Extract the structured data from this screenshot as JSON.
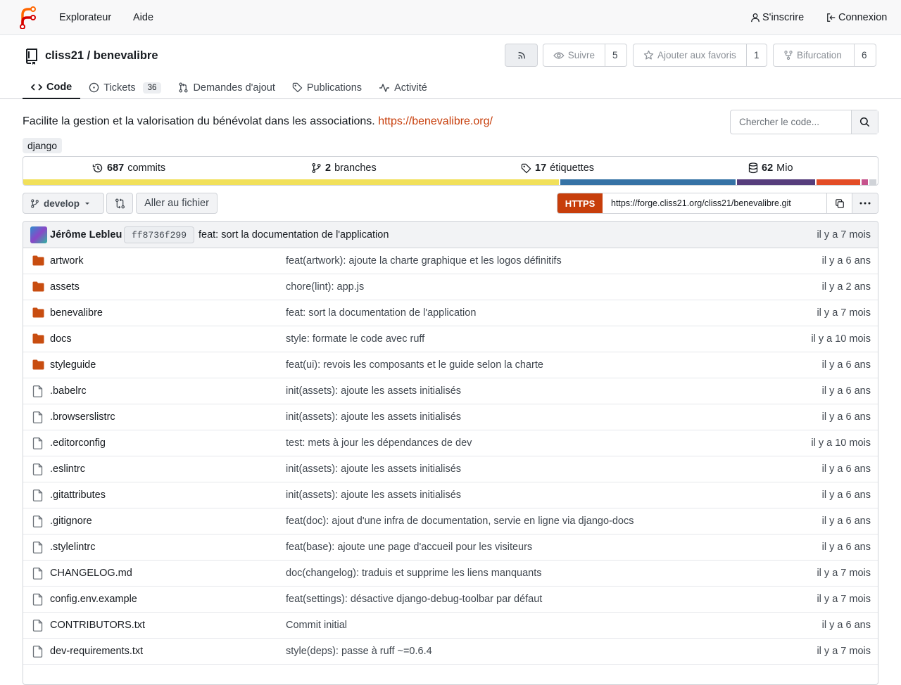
{
  "nav": {
    "explore": "Explorateur",
    "help": "Aide",
    "register": "S'inscrire",
    "login": "Connexion"
  },
  "repo": {
    "title": "cliss21 / benevalibre",
    "watch_label": "Suivre",
    "watch_count": "5",
    "star_label": "Ajouter aux favoris",
    "star_count": "1",
    "fork_label": "Bifurcation",
    "fork_count": "6"
  },
  "tabs": [
    {
      "label": "Code",
      "icon": "code-icon"
    },
    {
      "label": "Tickets",
      "icon": "issue-icon",
      "badge": "36"
    },
    {
      "label": "Demandes d'ajout",
      "icon": "pull-request-icon"
    },
    {
      "label": "Publications",
      "icon": "tag-icon"
    },
    {
      "label": "Activité",
      "icon": "pulse-icon"
    }
  ],
  "description": {
    "text": "Facilite la gestion et la valorisation du bénévolat dans les associations.",
    "link": "https://benevalibre.org/"
  },
  "search": {
    "placeholder": "Chercher le code..."
  },
  "topic": "django",
  "stats": {
    "commits_count": "687",
    "commits_label": "commits",
    "branches_count": "2",
    "branches_label": "branches",
    "tags_count": "17",
    "tags_label": "étiquettes",
    "size_count": "62",
    "size_label": "Mio"
  },
  "languages": [
    {
      "color": "#f1e05a",
      "share": 63.3
    },
    {
      "color": "#3572a5",
      "share": 20.7
    },
    {
      "color": "#563d7c",
      "share": 9.3
    },
    {
      "color": "#e34c26",
      "share": 5.1
    },
    {
      "color": "#c6538c",
      "share": 0.8
    },
    {
      "color": "#d0d3d8",
      "share": 0.8
    }
  ],
  "toolbar": {
    "branch": "develop",
    "goto_file": "Aller au fichier",
    "protocol": "HTTPS",
    "clone_url": "https://forge.cliss21.org/cliss21/benevalibre.git"
  },
  "latest_commit": {
    "author": "Jérôme Lebleu",
    "sha": "ff8736f299",
    "message": "feat: sort la documentation de l'application",
    "time": "il y a 7 mois"
  },
  "files": [
    {
      "name": "artwork",
      "type": "dir",
      "message": "feat(artwork): ajoute la charte graphique et les logos définitifs",
      "time": "il y a 6 ans"
    },
    {
      "name": "assets",
      "type": "dir",
      "message": "chore(lint): app.js",
      "time": "il y a 2 ans"
    },
    {
      "name": "benevalibre",
      "type": "dir",
      "message": "feat: sort la documentation de l'application",
      "time": "il y a 7 mois"
    },
    {
      "name": "docs",
      "type": "dir",
      "message": "style: formate le code avec ruff",
      "time": "il y a 10 mois"
    },
    {
      "name": "styleguide",
      "type": "dir",
      "message": "feat(ui): revois les composants et le guide selon la charte",
      "time": "il y a 6 ans"
    },
    {
      "name": ".babelrc",
      "type": "file",
      "message": "init(assets): ajoute les assets initialisés",
      "time": "il y a 6 ans"
    },
    {
      "name": ".browserslistrc",
      "type": "file",
      "message": "init(assets): ajoute les assets initialisés",
      "time": "il y a 6 ans"
    },
    {
      "name": ".editorconfig",
      "type": "file",
      "message": "test: mets à jour les dépendances de dev",
      "time": "il y a 10 mois"
    },
    {
      "name": ".eslintrc",
      "type": "file",
      "message": "init(assets): ajoute les assets initialisés",
      "time": "il y a 6 ans"
    },
    {
      "name": ".gitattributes",
      "type": "file",
      "message": "init(assets): ajoute les assets initialisés",
      "time": "il y a 6 ans"
    },
    {
      "name": ".gitignore",
      "type": "file",
      "message": "feat(doc): ajout d'une infra de documentation, servie en ligne via django-docs",
      "time": "il y a 6 ans"
    },
    {
      "name": ".stylelintrc",
      "type": "file",
      "message": "feat(base): ajoute une page d'accueil pour les visiteurs",
      "time": "il y a 6 ans"
    },
    {
      "name": "CHANGELOG.md",
      "type": "file",
      "message": "doc(changelog): traduis et supprime les liens manquants",
      "time": "il y a 7 mois"
    },
    {
      "name": "config.env.example",
      "type": "file",
      "message": "feat(settings): désactive django-debug-toolbar par défaut",
      "time": "il y a 7 mois"
    },
    {
      "name": "CONTRIBUTORS.txt",
      "type": "file",
      "message": "Commit initial",
      "time": "il y a 6 ans"
    },
    {
      "name": "dev-requirements.txt",
      "type": "file",
      "message": "style(deps): passe à ruff ~=0.6.4",
      "time": "il y a 7 mois"
    }
  ]
}
